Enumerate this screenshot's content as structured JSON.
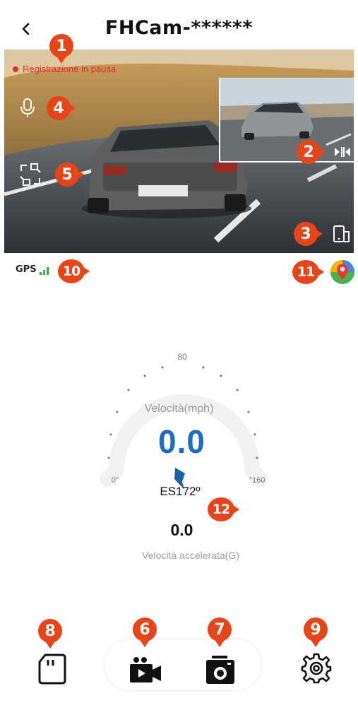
{
  "header": {
    "title": "FHCam-******"
  },
  "preview": {
    "recording_status": "Registrazione in pausa"
  },
  "gps": {
    "label": "GPS"
  },
  "gauge": {
    "ticks": {
      "min": "0°",
      "mid": "80",
      "max": "°160"
    },
    "speed_label": "Velocità(mph)",
    "speed_value": "0.0",
    "heading": "ES172º",
    "accel_value": "0.0",
    "accel_label": "Velocità accelerata(G)"
  },
  "badges": [
    "1",
    "2",
    "3",
    "4",
    "5",
    "6",
    "7",
    "8",
    "9",
    "10",
    "11",
    "12"
  ],
  "colors": {
    "badge": "#e8441a",
    "speed": "#1f6dbf",
    "rec": "#e42d2d",
    "gps_signal": "#3cb043"
  },
  "icons": [
    "back-icon",
    "microphone-icon",
    "camera-switch-icon",
    "swap-view-icon",
    "portrait-rotate-icon",
    "map-pin-icon",
    "sd-card-icon",
    "video-camera-icon",
    "photo-camera-icon",
    "settings-gear-icon",
    "direction-arrow-icon"
  ]
}
